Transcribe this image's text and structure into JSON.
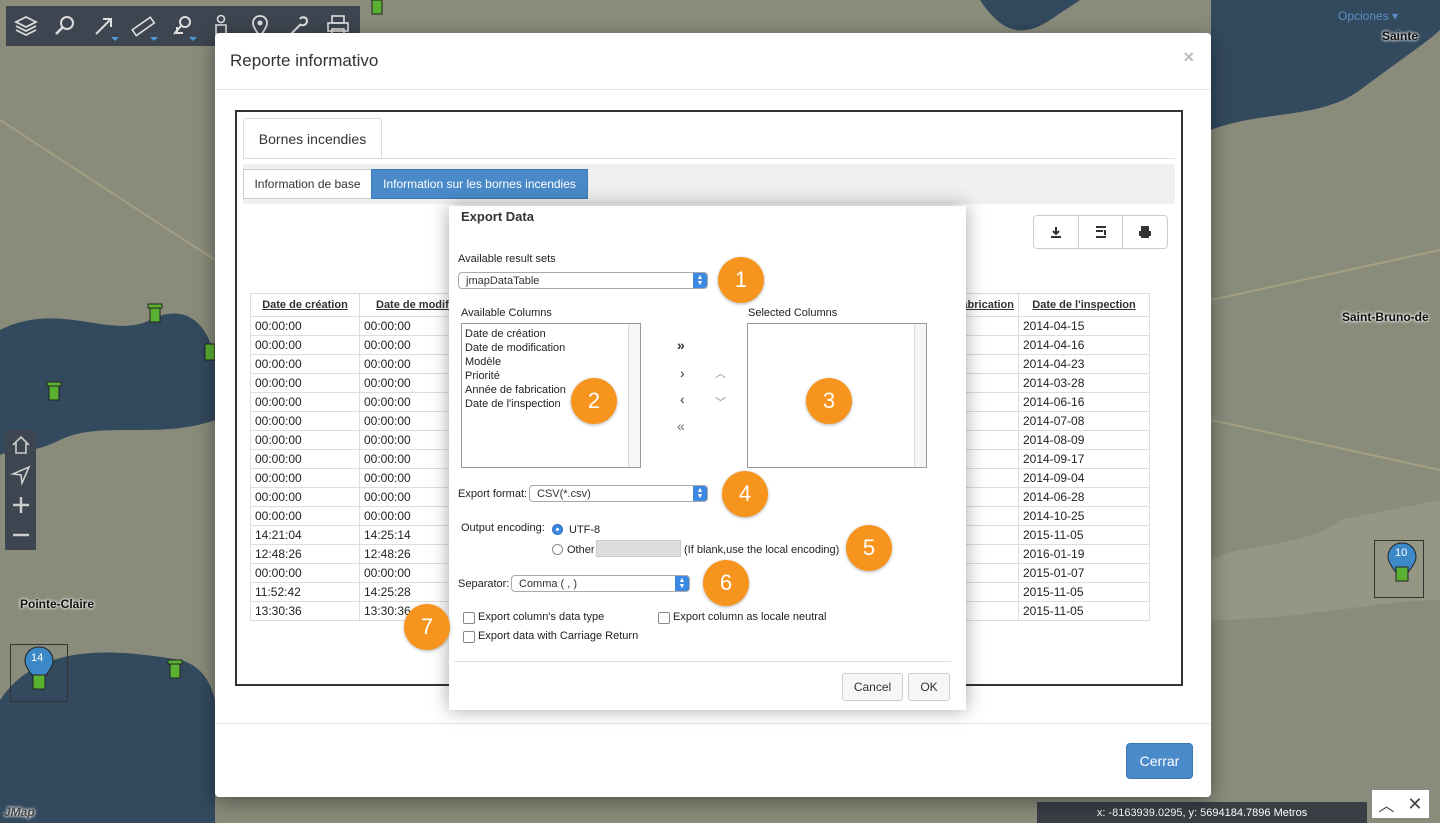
{
  "map": {
    "labels": {
      "pointe_claire": "Pointe-Claire",
      "saint_bruno": "Saint-Bruno-de",
      "sainte": "Sainte"
    },
    "options_label": "Opciones",
    "coords": "x: -8163939.0295, y: 5694184.7896 Metros",
    "watermark": "JMap",
    "markers": {
      "m14": "14",
      "m10": "10"
    }
  },
  "toolbar": {
    "icons": [
      "layers-icon",
      "search-icon",
      "arrow-icon",
      "measure-icon",
      "select-icon",
      "user-icon",
      "location-icon",
      "tools-icon",
      "print-icon"
    ]
  },
  "modal": {
    "title": "Reporte informativo",
    "close": "×",
    "close_button": "Cerrar",
    "main_tab": "Bornes incendies",
    "subtabs": [
      "Information de base",
      "Information sur les bornes incendies"
    ],
    "table": {
      "headers": [
        "Date de création",
        "Date de modific",
        "fabrication",
        "Date de l'inspection"
      ],
      "col1": [
        "00:00:00",
        "00:00:00",
        "00:00:00",
        "00:00:00",
        "00:00:00",
        "00:00:00",
        "00:00:00",
        "00:00:00",
        "00:00:00",
        "00:00:00",
        "00:00:00",
        "14:21:04",
        "12:48:26",
        "00:00:00",
        "11:52:42",
        "13:30:36"
      ],
      "col2": [
        "00:00:00",
        "00:00:00",
        "00:00:00",
        "00:00:00",
        "00:00:00",
        "00:00:00",
        "00:00:00",
        "00:00:00",
        "00:00:00",
        "00:00:00",
        "00:00:00",
        "14:25:14",
        "12:48:26",
        "00:00:00",
        "14:25:28",
        "13:30:36"
      ],
      "col4": [
        "2014-04-15",
        "2014-04-16",
        "2014-04-23",
        "2014-03-28",
        "2014-06-16",
        "2014-07-08",
        "2014-08-09",
        "2014-09-17",
        "2014-09-04",
        "2014-06-28",
        "2014-10-25",
        "2015-11-05",
        "2016-01-19",
        "2015-01-07",
        "2015-11-05",
        "2015-11-05"
      ]
    }
  },
  "export": {
    "title": "Export Data",
    "result_sets_label": "Available result sets",
    "result_set_value": "jmapDataTable",
    "available_columns_label": "Available Columns",
    "available_columns": [
      "Date de création",
      "Date de modification",
      "Modèle",
      "Priorité",
      "Année de fabrication",
      "Date de l'inspection"
    ],
    "selected_columns_label": "Selected Columns",
    "export_format_label": "Export format:",
    "export_format_value": "CSV(*.csv)",
    "output_encoding_label": "Output encoding:",
    "utf8_label": "UTF-8",
    "other_label": "Other",
    "other_hint": "(If blank,use the local encoding)",
    "separator_label": "Separator:",
    "separator_value": "Comma ( , )",
    "chk_data_type": "Export column's data type",
    "chk_locale": "Export column as locale neutral",
    "chk_carriage": "Export data with Carriage Return",
    "cancel": "Cancel",
    "ok": "OK",
    "badges": [
      "1",
      "2",
      "3",
      "4",
      "5",
      "6",
      "7"
    ],
    "accent": "#f7941d"
  }
}
